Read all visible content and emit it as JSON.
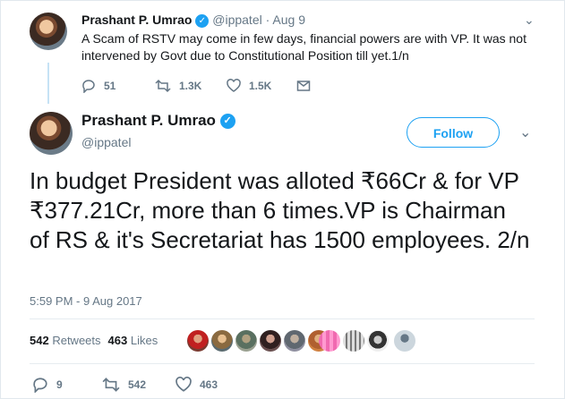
{
  "tweet1": {
    "name": "Prashant P. Umrao",
    "handle": "@ippatel",
    "dot": "·",
    "date": "Aug 9",
    "text": "A Scam of RSTV may come in few days, financial powers are with VP. It was not intervened by Govt due to Constitutional Position till yet.1/n",
    "replies": "51",
    "retweets": "1.3K",
    "likes": "1.5K"
  },
  "tweet2": {
    "name": "Prashant P. Umrao",
    "handle": "@ippatel",
    "follow_label": "Follow",
    "text": "In budget President was alloted ₹66Cr & for VP ₹377.21Cr, more than 6 times.VP is Chairman of RS & it's Secretariat has 1500 employees. 2/n",
    "timestamp": "5:59 PM - 9 Aug 2017",
    "retweet_count": "542",
    "retweet_label": "Retweets",
    "like_count": "463",
    "like_label": "Likes",
    "replies": "9",
    "retweets": "542",
    "likes": "463"
  },
  "colors": {
    "accent": "#1da1f2",
    "muted": "#657786",
    "thread_line": "#c6e2f5"
  },
  "icons": [
    "verified-icon",
    "caret-down-icon",
    "reply-icon",
    "retweet-icon",
    "like-icon",
    "dm-icon",
    "avatar"
  ]
}
